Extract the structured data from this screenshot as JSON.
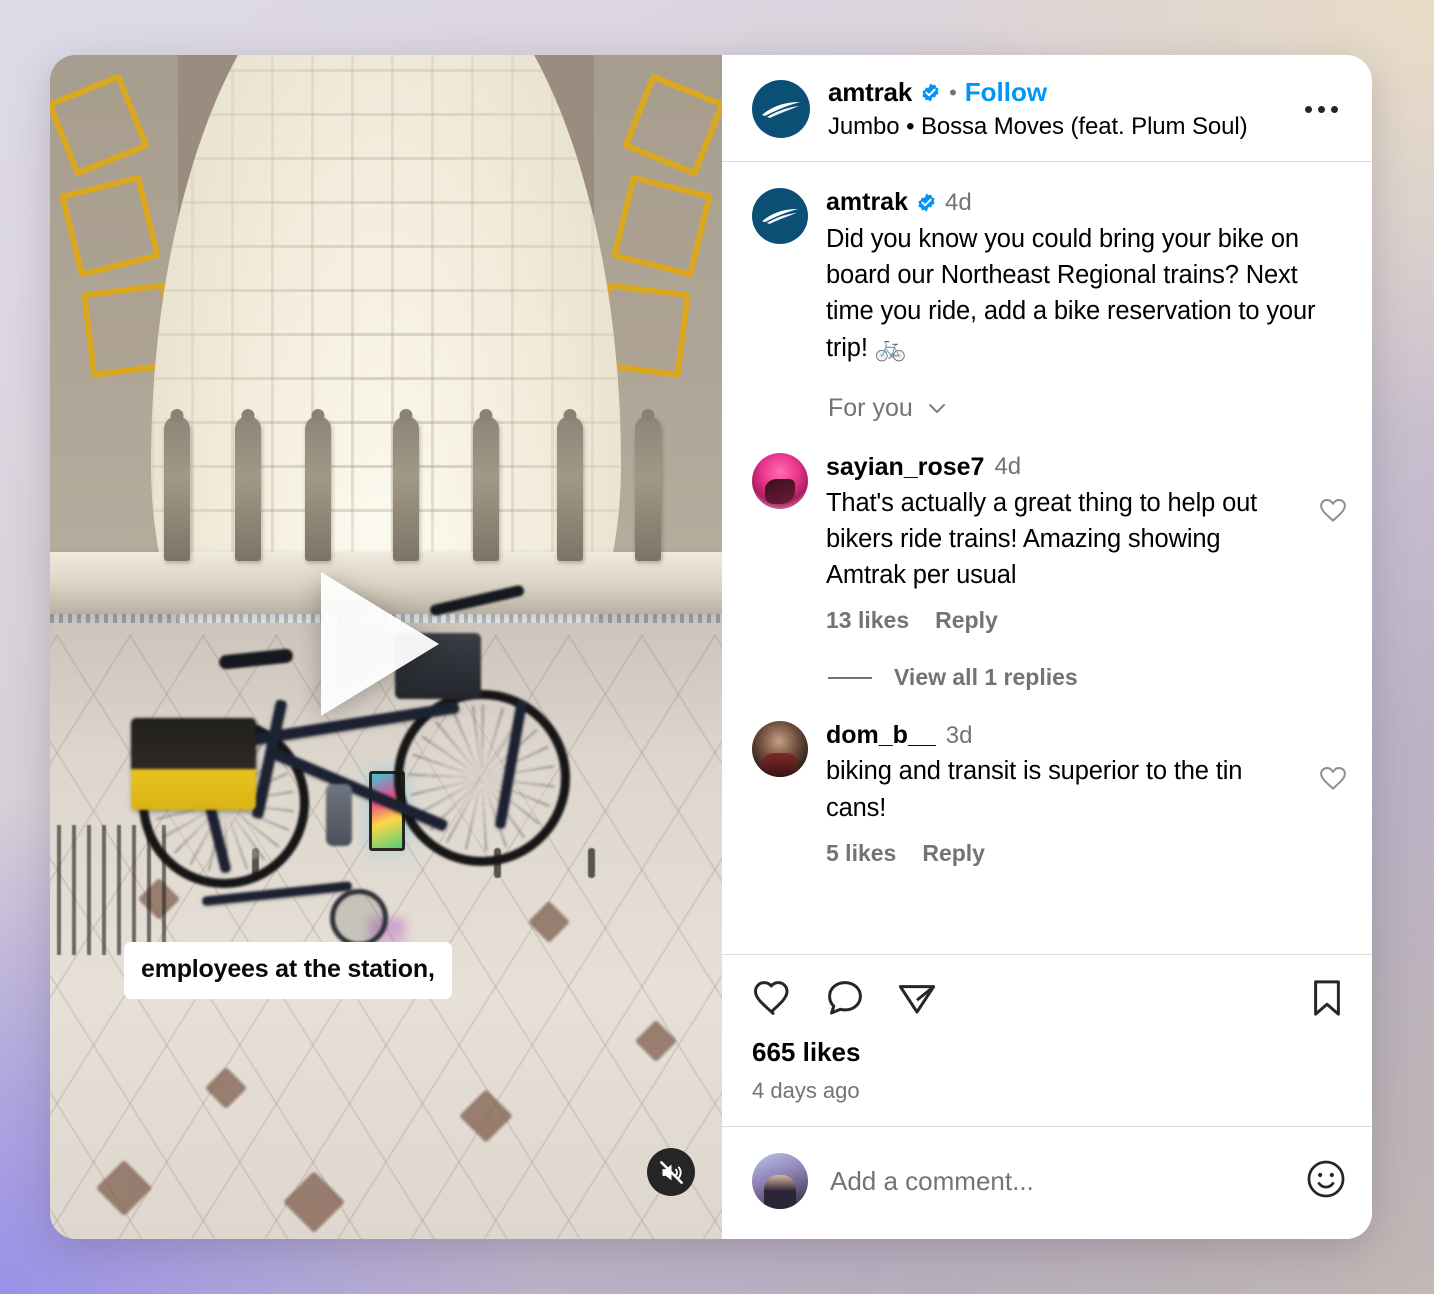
{
  "post": {
    "header": {
      "username": "amtrak",
      "verified": true,
      "separator": "•",
      "follow_label": "Follow",
      "audio_attribution": "Jumbo • Bossa Moves (feat. Plum Soul)",
      "more_options_icon": "ellipsis-icon"
    },
    "media": {
      "type": "video",
      "play_icon": "play-icon",
      "mute_icon": "speaker-muted-icon",
      "caption_overlay": "employees at the station,",
      "scene_description": "bicycle parked in Union Station main hall"
    },
    "caption": {
      "username": "amtrak",
      "verified": true,
      "time": "4d",
      "text": "Did you know you could bring your bike on board our Northeast Regional trains? Next time you ride, add a bike reservation to your trip! 🚲"
    },
    "comment_filter": {
      "label": "For you",
      "chevron_icon": "chevron-down-icon"
    },
    "comments": [
      {
        "username": "sayian_rose7",
        "time": "4d",
        "text": "That's actually a great thing to help out bikers ride trains! Amazing showing Amtrak per usual",
        "likes_label": "13 likes",
        "reply_label": "Reply",
        "like_icon": "heart-outline-icon",
        "avatar": "rose-anime-avatar",
        "replies_label": "View all 1 replies"
      },
      {
        "username": "dom_b__",
        "time": "3d",
        "text": "biking and transit is superior to the tin cans!",
        "likes_label": "5 likes",
        "reply_label": "Reply",
        "like_icon": "heart-outline-icon",
        "avatar": "dom-portrait-avatar"
      }
    ],
    "actions": {
      "like_icon": "heart-outline-icon",
      "comment_icon": "comment-bubble-icon",
      "share_icon": "share-paperplane-icon",
      "save_icon": "bookmark-outline-icon",
      "likes_count": "665 likes",
      "timestamp": "4 days ago"
    },
    "comment_input": {
      "placeholder": "Add a comment...",
      "emoji_icon": "emoji-smiley-icon",
      "avatar": "current-user-avatar"
    }
  },
  "colors": {
    "link_blue": "#0095f6",
    "verified_blue": "#0095f6",
    "text_primary": "#000000",
    "text_secondary": "#737373",
    "amtrak_navy": "#0b4f75",
    "divider": "#dbdbdb"
  }
}
